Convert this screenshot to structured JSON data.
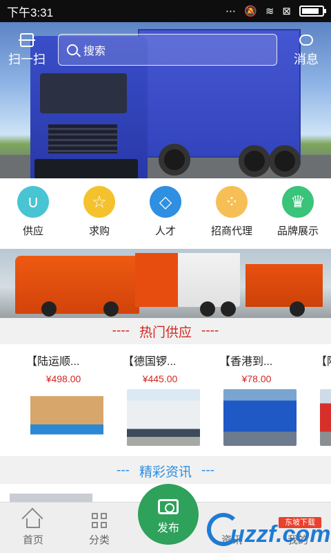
{
  "status_bar": {
    "time": "下午3:31",
    "icons": [
      "more-icon",
      "mute-icon",
      "wifi-icon",
      "sim-icon",
      "battery-icon"
    ],
    "battery_level": 0.85
  },
  "header": {
    "scan_label": "扫一扫",
    "search_placeholder": "搜索",
    "message_label": "消息"
  },
  "hero": {
    "slide_count": 3,
    "active_slide": 2
  },
  "categories": [
    {
      "label": "供应",
      "icon": "horseshoe-icon",
      "color": "#49c4d3"
    },
    {
      "label": "求购",
      "icon": "star-icon",
      "color": "#f4c22d"
    },
    {
      "label": "人才",
      "icon": "diamond-icon",
      "color": "#2f8fe0"
    },
    {
      "label": "招商代理",
      "icon": "diamond-dots-icon",
      "color": "#f6bf56"
    },
    {
      "label": "品牌展示",
      "icon": "crown-icon",
      "color": "#3ac37a"
    }
  ],
  "hot_section": {
    "title": "热门供应",
    "dash": "----",
    "color": "#d2261f"
  },
  "products": [
    {
      "title": "【陆运顺...",
      "price": "¥498.00"
    },
    {
      "title": "【德国锣...",
      "price": "¥445.00"
    },
    {
      "title": "【香港到...",
      "price": "¥78.00"
    },
    {
      "title": "【陆",
      "price": "¥"
    }
  ],
  "news_section": {
    "title": "精彩资讯",
    "dash": "---",
    "color": "#2f8fe0"
  },
  "bottom_nav": {
    "home": "首页",
    "category": "分类",
    "publish": "发布",
    "news": "资讯",
    "mine": "我的"
  },
  "watermark": {
    "text": "uzzf.com",
    "tag": "东坡下载"
  }
}
